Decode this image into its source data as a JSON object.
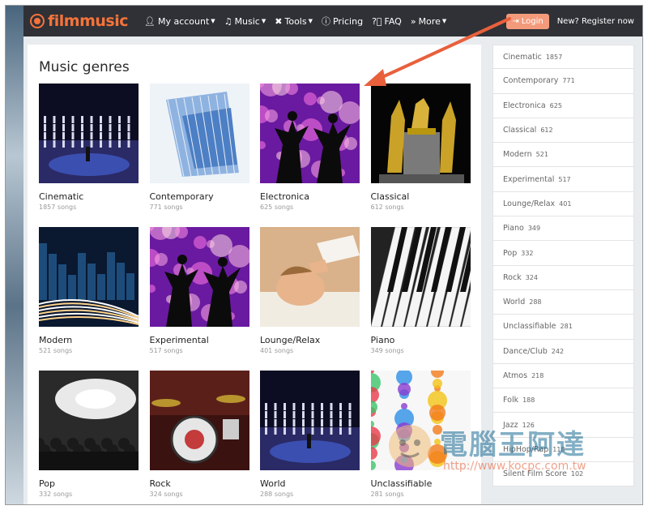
{
  "brand": {
    "logo_text": "filmmusic",
    "accent": "#f6733a"
  },
  "nav": {
    "items": [
      {
        "icon": "user-icon",
        "label": "My account",
        "caret": true
      },
      {
        "icon": "music-note-icon",
        "label": "Music",
        "caret": true
      },
      {
        "icon": "tools-icon",
        "label": "Tools",
        "caret": true
      },
      {
        "icon": "info-icon",
        "label": "Pricing",
        "caret": false
      },
      {
        "icon": "question-icon",
        "label": "FAQ",
        "caret": false
      },
      {
        "icon": "double-chevron-icon",
        "label": "More",
        "caret": true
      }
    ],
    "login_label": "Login",
    "register_label": "New? Register now"
  },
  "main": {
    "title": "Music genres",
    "genres": [
      {
        "name": "Cinematic",
        "count": "1857 songs",
        "thumb": "orchestra-stage-image"
      },
      {
        "name": "Contemporary",
        "count": "771 songs",
        "thumb": "glass-building-image"
      },
      {
        "name": "Electronica",
        "count": "625 songs",
        "thumb": "dancing-silhouettes-image"
      },
      {
        "name": "Classical",
        "count": "612 songs",
        "thumb": "golden-statues-image"
      },
      {
        "name": "Modern",
        "count": "521 songs",
        "thumb": "night-city-image"
      },
      {
        "name": "Experimental",
        "count": "517 songs",
        "thumb": "dancing-silhouettes-image"
      },
      {
        "name": "Lounge/Relax",
        "count": "401 songs",
        "thumb": "massage-image"
      },
      {
        "name": "Piano",
        "count": "349 songs",
        "thumb": "piano-keys-image"
      },
      {
        "name": "Pop",
        "count": "332 songs",
        "thumb": "concert-crowd-image"
      },
      {
        "name": "Rock",
        "count": "324 songs",
        "thumb": "drum-kit-image"
      },
      {
        "name": "World",
        "count": "288 songs",
        "thumb": "orchestra-stage-image"
      },
      {
        "name": "Unclassifiable",
        "count": "281 songs",
        "thumb": "paint-splash-image"
      }
    ]
  },
  "sidebar": {
    "items": [
      {
        "label": "Cinematic",
        "count": "1857"
      },
      {
        "label": "Contemporary",
        "count": "771"
      },
      {
        "label": "Electronica",
        "count": "625"
      },
      {
        "label": "Classical",
        "count": "612"
      },
      {
        "label": "Modern",
        "count": "521"
      },
      {
        "label": "Experimental",
        "count": "517"
      },
      {
        "label": "Lounge/Relax",
        "count": "401"
      },
      {
        "label": "Piano",
        "count": "349"
      },
      {
        "label": "Pop",
        "count": "332"
      },
      {
        "label": "Rock",
        "count": "324"
      },
      {
        "label": "World",
        "count": "288"
      },
      {
        "label": "Unclassifiable",
        "count": "281"
      },
      {
        "label": "Dance/Club",
        "count": "242"
      },
      {
        "label": "Atmos",
        "count": "218"
      },
      {
        "label": "Folk",
        "count": "188"
      },
      {
        "label": "Jazz",
        "count": "126"
      },
      {
        "label": "HipHop/Rap",
        "count": "118"
      },
      {
        "label": "Silent Film Score",
        "count": "102"
      }
    ]
  },
  "watermark": {
    "title": "電腦王阿達",
    "url": "http://www.kocpc.com.tw"
  },
  "colors": {
    "navbar": "#2f3136",
    "login_button": "#f39a7b",
    "arrow": "#e8603c"
  }
}
